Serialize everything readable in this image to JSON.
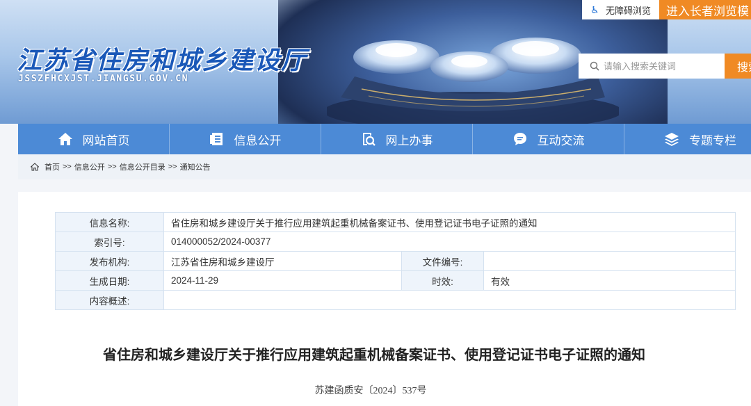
{
  "header": {
    "site_title": "江苏省住房和城乡建设厅",
    "site_domain": "JSSZFHCXJST.JIANGSU.GOV.CN",
    "accessibility_label": "无障碍浏览",
    "elder_label": "进入长者浏览模",
    "search_placeholder": "请输入搜索关键词",
    "search_button": "搜索"
  },
  "nav": {
    "items": [
      {
        "label": "网站首页",
        "icon": "home-icon"
      },
      {
        "label": "信息公开",
        "icon": "document-icon"
      },
      {
        "label": "网上办事",
        "icon": "service-icon"
      },
      {
        "label": "互动交流",
        "icon": "chat-icon"
      },
      {
        "label": "专题专栏",
        "icon": "layers-icon"
      }
    ]
  },
  "breadcrumb": {
    "items": [
      "首页",
      "信息公开",
      "信息公开目录",
      "通知公告"
    ],
    "separator": ">>"
  },
  "meta": {
    "name_label": "信息名称:",
    "name_value": "省住房和城乡建设厅关于推行应用建筑起重机械备案证书、使用登记证书电子证照的通知",
    "index_label": "索引号:",
    "index_value": "014000052/2024-00377",
    "org_label": "发布机构:",
    "org_value": "江苏省住房和城乡建设厅",
    "file_no_label": "文件编号:",
    "file_no_value": "",
    "date_label": "生成日期:",
    "date_value": "2024-11-29",
    "validity_label": "时效:",
    "validity_value": "有效",
    "summary_label": "内容概述:",
    "summary_value": ""
  },
  "document": {
    "title": "省住房和城乡建设厅关于推行应用建筑起重机械备案证书、使用登记证书电子证照的通知",
    "number": "苏建函质安〔2024〕537号"
  },
  "colors": {
    "nav_bg": "#4c8ad6",
    "accent_orange": "#f08a24",
    "title_blue": "#1a58b8"
  }
}
